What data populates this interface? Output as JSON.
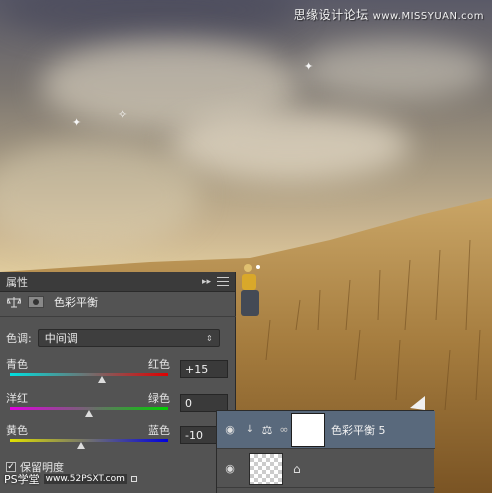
{
  "watermark": {
    "top_text": "思缘设计论坛",
    "top_site": "www.MISSYUAN.com",
    "bottom_ps": "PS学堂",
    "bottom_site": "www.52PSXT.com"
  },
  "properties_panel": {
    "tab": "属性",
    "collapse_glyph": "▸▸",
    "title": "色彩平衡",
    "tone_label": "色调:",
    "tone_value": "中间调",
    "sliders": [
      {
        "left": "青色",
        "right": "红色",
        "value": "+15",
        "position": 0.58,
        "colors": [
          "#00e0e0",
          "#e00000"
        ]
      },
      {
        "left": "洋红",
        "right": "绿色",
        "value": "0",
        "position": 0.5,
        "colors": [
          "#e000e0",
          "#00d000"
        ]
      },
      {
        "left": "黄色",
        "right": "蓝色",
        "value": "-10",
        "position": 0.45,
        "colors": [
          "#e0e000",
          "#0000e0"
        ]
      }
    ],
    "preserve_luminosity": "保留明度",
    "preserve_checked": true
  },
  "layers_panel": {
    "layers": [
      {
        "name": "色彩平衡 5",
        "selected": true,
        "type": "adjustment"
      },
      {
        "name": "",
        "selected": false,
        "type": "pixel"
      }
    ]
  },
  "colors": {
    "panel": "#535353",
    "panel_dark": "#3b3b3b",
    "selected_layer": "#59697c"
  }
}
